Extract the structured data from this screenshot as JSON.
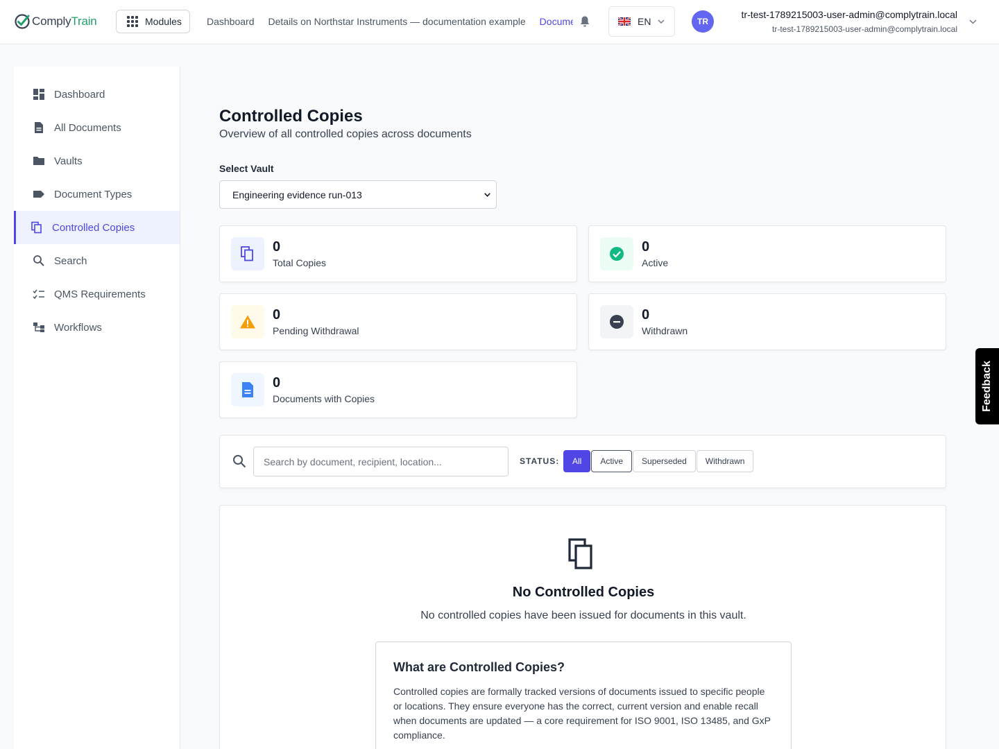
{
  "header": {
    "logo_part1": "Comply",
    "logo_part2": "Train",
    "modules_label": "Modules",
    "breadcrumbs": [
      "Dashboard",
      "Details on Northstar Instruments — documentation example",
      "Documents"
    ],
    "language": "EN",
    "avatar_initials": "TR",
    "user_name": "tr-test-1789215003-user-admin@complytrain.local",
    "user_email": "tr-test-1789215003-user-admin@complytrain.local"
  },
  "sidebar": {
    "items": [
      {
        "label": "Dashboard",
        "icon": "dashboard-icon"
      },
      {
        "label": "All Documents",
        "icon": "document-icon"
      },
      {
        "label": "Vaults",
        "icon": "folder-icon"
      },
      {
        "label": "Document Types",
        "icon": "label-icon"
      },
      {
        "label": "Controlled Copies",
        "icon": "copy-icon",
        "active": true
      },
      {
        "label": "Search",
        "icon": "search-icon"
      },
      {
        "label": "QMS Requirements",
        "icon": "checklist-icon"
      },
      {
        "label": "Workflows",
        "icon": "workflow-icon"
      }
    ]
  },
  "main": {
    "title": "Controlled Copies",
    "subtitle": "Overview of all controlled copies across documents",
    "vault_label": "Select Vault",
    "vault_selected": "Engineering evidence run-013",
    "stats": [
      {
        "value": "0",
        "label": "Total Copies",
        "icon": "copy-icon",
        "color": "#4f46e5"
      },
      {
        "value": "0",
        "label": "Active",
        "icon": "check-circle-icon",
        "color": "#10b981"
      },
      {
        "value": "0",
        "label": "Pending Withdrawal",
        "icon": "warning-icon",
        "color": "#f59e0b"
      },
      {
        "value": "0",
        "label": "Withdrawn",
        "icon": "minus-circle-icon",
        "color": "#374151"
      },
      {
        "value": "0",
        "label": "Documents with Copies",
        "icon": "document-icon",
        "color": "#3b82f6"
      }
    ],
    "search_placeholder": "Search by document, recipient, location...",
    "status_label": "STATUS:",
    "status_filters": [
      "All",
      "Active",
      "Superseded",
      "Withdrawn"
    ],
    "empty_title": "No Controlled Copies",
    "empty_desc": "No controlled copies have been issued for documents in this vault.",
    "info_title": "What are Controlled Copies?",
    "info_text": "Controlled copies are formally tracked versions of documents issued to specific people or locations. They ensure everyone has the correct, current version and enable recall when documents are updated — a core requirement for ISO 9001, ISO 13485, and GxP compliance."
  },
  "feedback_label": "Feedback"
}
